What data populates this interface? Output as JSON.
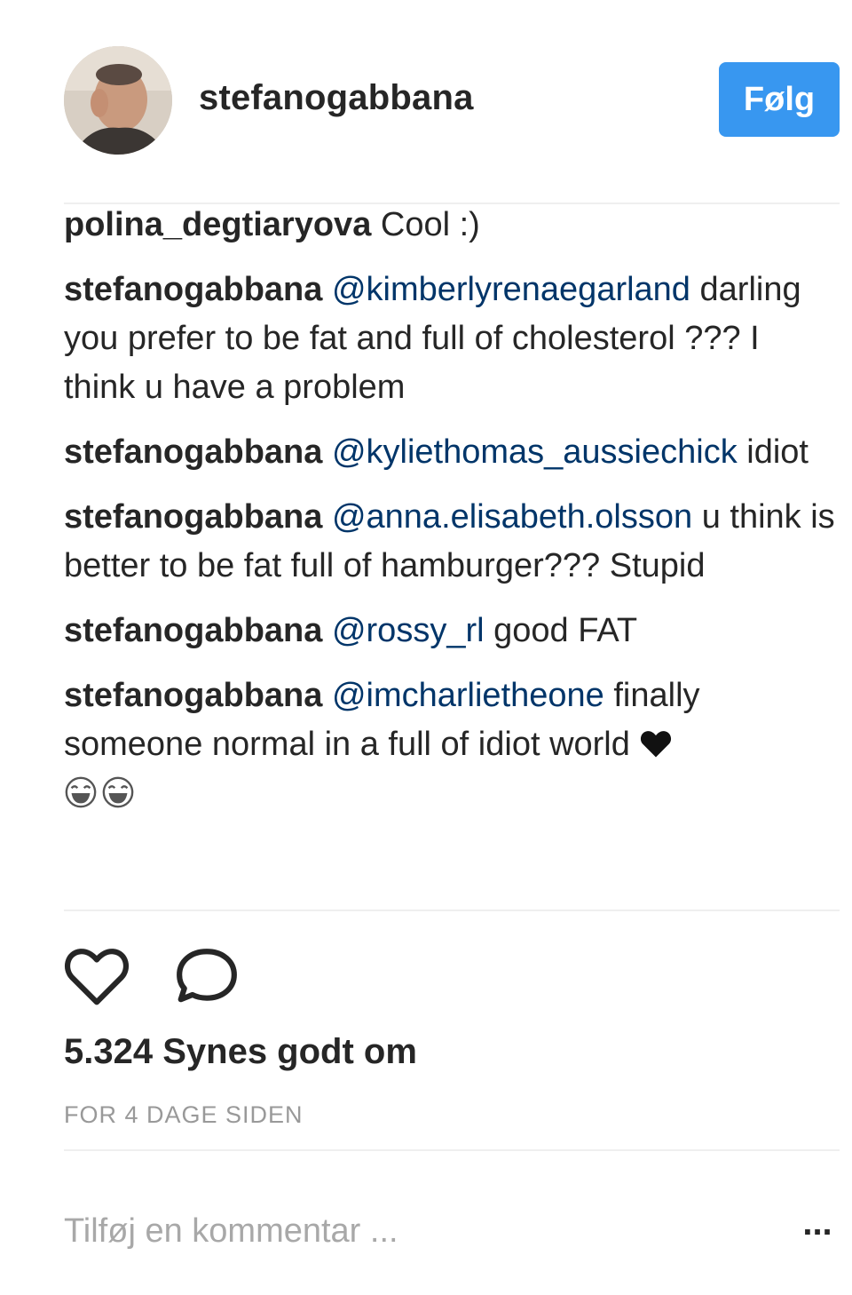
{
  "header": {
    "username": "stefanogabbana",
    "follow_label": "Følg"
  },
  "comments": [
    {
      "user": "polina_degtiaryova",
      "mention": "",
      "text": "Cool :)"
    },
    {
      "user": "stefanogabbana",
      "mention": "@kimberlyrenaegarland",
      "text": "darling you prefer to be fat and full of cholesterol ??? I think u have a problem"
    },
    {
      "user": "stefanogabbana",
      "mention": "@kyliethomas_aussiechick",
      "text": "idiot"
    },
    {
      "user": "stefanogabbana",
      "mention": "@anna.elisabeth.olsson",
      "text": "u think is better to be fat full of hamburger??? Stupid"
    },
    {
      "user": "stefanogabbana",
      "mention": "@rossy_rl",
      "text": "good FAT"
    },
    {
      "user": "stefanogabbana",
      "mention": "@imcharlietheone",
      "text": "finally someone normal in a full of idiot world"
    }
  ],
  "icons": {
    "like": "heart-outline-icon",
    "comment": "comment-bubble-icon",
    "emoji": "laughing-emoji-icon",
    "heart": "black-heart-icon"
  },
  "likes_text": "5.324 Synes godt om",
  "timestamp": "FOR 4 DAGE SIDEN",
  "add_comment": {
    "placeholder": "Tilføj en kommentar ..."
  },
  "more_label": "...",
  "colors": {
    "follow_button": "#3897f0",
    "mention": "#003569",
    "text": "#262626",
    "muted": "#999999"
  }
}
